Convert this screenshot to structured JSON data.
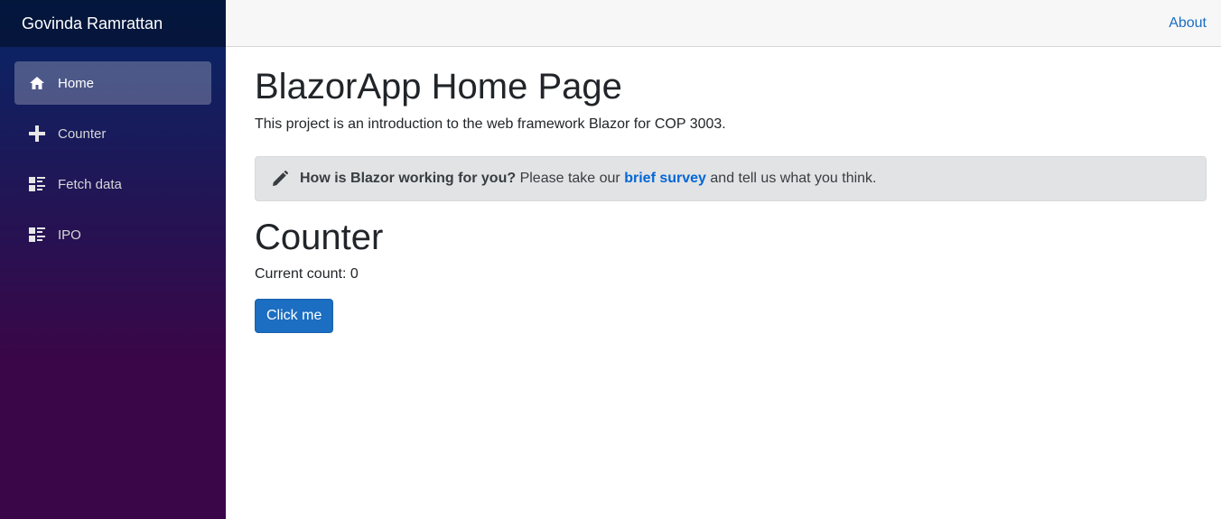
{
  "app": {
    "brand": "Govinda Ramrattan"
  },
  "sidebar": {
    "items": [
      {
        "label": "Home",
        "icon": "home-icon",
        "active": true
      },
      {
        "label": "Counter",
        "icon": "plus-icon",
        "active": false
      },
      {
        "label": "Fetch data",
        "icon": "list-rich-icon",
        "active": false
      },
      {
        "label": "IPO",
        "icon": "list-rich-icon",
        "active": false
      }
    ]
  },
  "top_row": {
    "about": "About"
  },
  "main": {
    "title": "BlazorApp Home Page",
    "intro": "This project is an introduction to the web framework Blazor for COP 3003.",
    "survey": {
      "icon": "pencil-icon",
      "question": "How is Blazor working for you?",
      "prefix": "Please take our",
      "link": "brief survey",
      "suffix": "and tell us what you think."
    },
    "counter": {
      "title": "Counter",
      "count_label": "Current count: 0",
      "button": "Click me"
    }
  },
  "colors": {
    "accent": "#1b6ec2",
    "link": "#0366d6",
    "sidebar_top": "#052767",
    "sidebar_bottom": "#3a0647"
  }
}
